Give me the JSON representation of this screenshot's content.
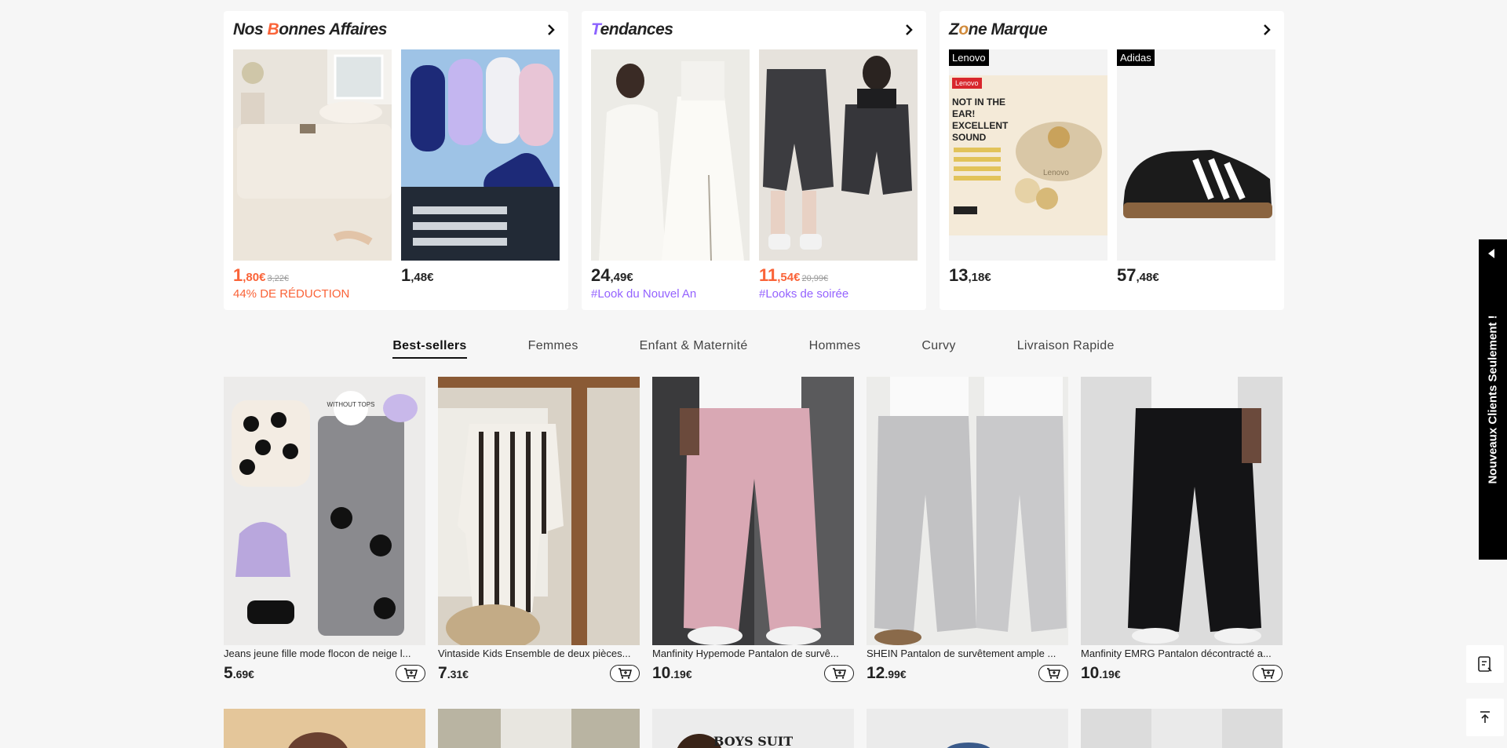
{
  "promos": [
    {
      "title_main": "Nos ",
      "title_accent": "B",
      "title_rest": "onnes Affaires",
      "items": [
        {
          "price_big": "1",
          "price_small": ",80€",
          "old_price": "3,22€",
          "tag": "44% DE RÉDUCTION",
          "sale": true
        },
        {
          "price_big": "1",
          "price_small": ",48€",
          "old_price": "",
          "tag": "",
          "sale": false
        }
      ]
    },
    {
      "title_main": "",
      "title_accent": "T",
      "title_rest": "endances",
      "items": [
        {
          "price_big": "24",
          "price_small": ",49€",
          "old_price": "",
          "tag": "#Look du Nouvel An",
          "sale": false
        },
        {
          "price_big": "11",
          "price_small": ",54€",
          "old_price": "20,99€",
          "tag": "#Looks de soirée",
          "sale": true
        }
      ]
    },
    {
      "title_main": "Z",
      "title_accent": "o",
      "title_rest": "ne Marque",
      "items": [
        {
          "price_big": "13",
          "price_small": ",18€",
          "old_price": "",
          "tag": "",
          "brand": "Lenovo",
          "sale": false
        },
        {
          "price_big": "57",
          "price_small": ",48€",
          "old_price": "",
          "tag": "",
          "brand": "Adidas",
          "sale": false
        }
      ]
    }
  ],
  "earbuds_ad": {
    "badge": "Lenovo",
    "headline": "NOT IN THE EAR! EXCELLENT SOUND QUALITY",
    "case_label": "Lenovo"
  },
  "tabs": [
    "Best-sellers",
    "Femmes",
    "Enfant & Maternité",
    "Hommes",
    "Curvy",
    "Livraison Rapide"
  ],
  "products": [
    {
      "title": "Jeans jeune fille mode flocon de neige l...",
      "price_big": "5",
      "price_small": ".69€",
      "image_label": "WITHOUT TOPS"
    },
    {
      "title": "Vintaside Kids Ensemble de deux pièces...",
      "price_big": "7",
      "price_small": ".31€"
    },
    {
      "title": "Manfinity Hypemode Pantalon de survê...",
      "price_big": "10",
      "price_small": ".19€"
    },
    {
      "title": "SHEIN Pantalon de survêtement ample ...",
      "price_big": "12",
      "price_small": ".99€"
    },
    {
      "title": "Manfinity EMRG Pantalon décontracté a...",
      "price_big": "10",
      "price_small": ".19€"
    }
  ],
  "row2": {
    "boys_suit": "BOYS SUIT"
  },
  "side_banner": "Nouveaux Clients Seulement !",
  "colors": {
    "sale": "#fa6338",
    "purple": "#9462ff",
    "bg": "#f6f6f6"
  }
}
